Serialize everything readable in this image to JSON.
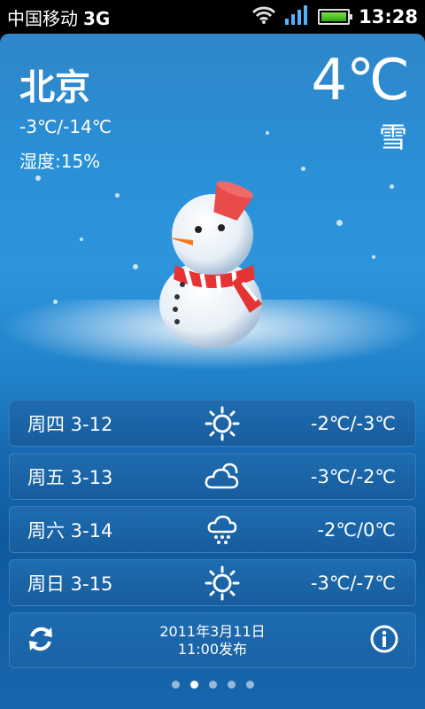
{
  "status_bar": {
    "carrier": "中国移动",
    "network": "3G",
    "time": "13:28",
    "icons": [
      "wifi-icon",
      "signal-icon",
      "battery-icon"
    ]
  },
  "current": {
    "city": "北京",
    "temperature": "4℃",
    "condition": "雪",
    "temp_range": "-3℃/-14℃",
    "humidity": "湿度:15%"
  },
  "forecast": [
    {
      "day": "周四 3-12",
      "icon": "sunny-icon",
      "range": "-2℃/-3℃"
    },
    {
      "day": "周五 3-13",
      "icon": "cloudy-icon",
      "range": "-3℃/-2℃"
    },
    {
      "day": "周六 3-14",
      "icon": "snow-icon",
      "range": "-2℃/0℃"
    },
    {
      "day": "周日 3-15",
      "icon": "sunny-icon",
      "range": "-3℃/-7℃"
    }
  ],
  "footer": {
    "date": "2011年3月11日",
    "publish_time": "11:00发布",
    "refresh_icon": "refresh-icon",
    "info_icon": "info-icon"
  },
  "page_indicator": {
    "count": 5,
    "active": 1
  },
  "colors": {
    "background": "#2a8fd6",
    "row": "#1a63a6",
    "text": "#ffffff"
  }
}
